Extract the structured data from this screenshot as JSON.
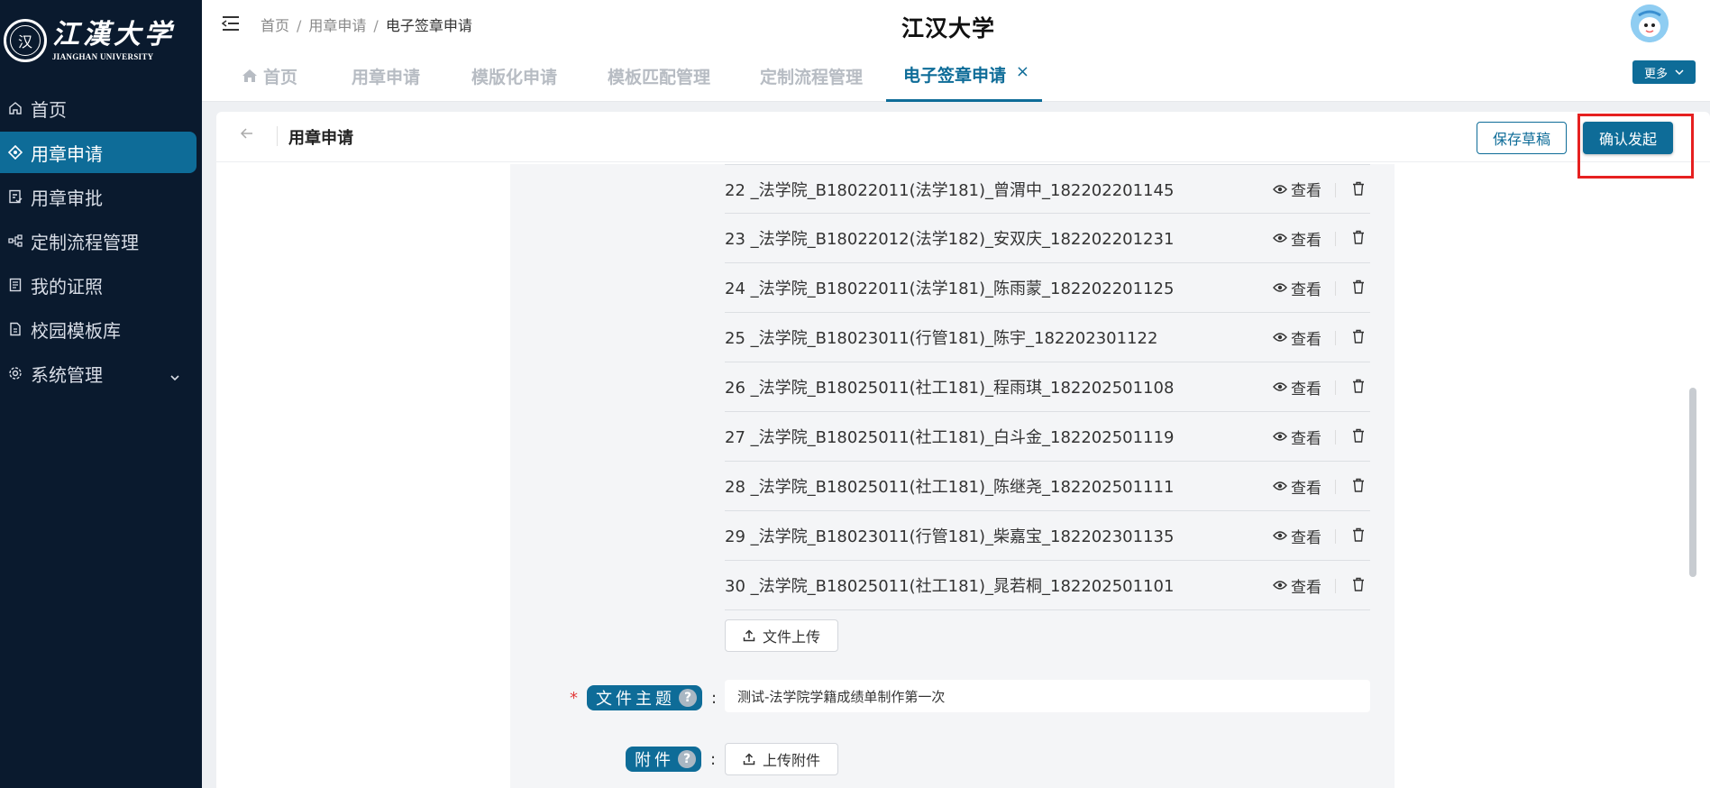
{
  "sidebar": {
    "logo_cn": "江漢大学",
    "logo_en": "JIANGHAN UNIVERSITY",
    "logo_seal": "汉",
    "items": [
      {
        "label": "首页",
        "icon": "home-icon",
        "active": false
      },
      {
        "label": "用章申请",
        "icon": "diamond-icon",
        "active": true
      },
      {
        "label": "用章审批",
        "icon": "approve-icon",
        "active": false
      },
      {
        "label": "定制流程管理",
        "icon": "flow-icon",
        "active": false
      },
      {
        "label": "我的证照",
        "icon": "certificate-icon",
        "active": false
      },
      {
        "label": "校园模板库",
        "icon": "template-icon",
        "active": false
      },
      {
        "label": "系统管理",
        "icon": "gear-icon",
        "active": false
      }
    ]
  },
  "header": {
    "breadcrumb": [
      "首页",
      "用章申请",
      "电子签章申请"
    ],
    "separator": "/",
    "title": "江汉大学"
  },
  "tabs": [
    {
      "label": "首页"
    },
    {
      "label": "用章申请"
    },
    {
      "label": "模版化申请"
    },
    {
      "label": "模板匹配管理"
    },
    {
      "label": "定制流程管理"
    },
    {
      "label": "电子签章申请",
      "active": true,
      "close": "×"
    }
  ],
  "more_button": "更多",
  "page": {
    "title": "用章申请",
    "save_draft": "保存草稿",
    "confirm_submit": "确认发起"
  },
  "files": [
    {
      "name": "22 _法学院_B18022011(法学181)_曾渭中_182202201145"
    },
    {
      "name": "23 _法学院_B18022012(法学182)_安双庆_182202201231"
    },
    {
      "name": "24 _法学院_B18022011(法学181)_陈雨蒙_182202201125"
    },
    {
      "name": "25 _法学院_B18023011(行管181)_陈宇_182202301122"
    },
    {
      "name": "26 _法学院_B18025011(社工181)_程雨琪_182202501108"
    },
    {
      "name": "27 _法学院_B18025011(社工181)_白斗金_182202501119"
    },
    {
      "name": "28 _法学院_B18025011(社工181)_陈继尧_182202501111"
    },
    {
      "name": "29 _法学院_B18023011(行管181)_柴嘉宝_182202301135"
    },
    {
      "name": "30 _法学院_B18025011(社工181)_晁若桐_182202501101"
    }
  ],
  "file_actions": {
    "view": "查看"
  },
  "upload_file": "文件上传",
  "form": {
    "subject_label": "文件主题",
    "subject_value": "测试-法学院学籍成绩单制作第一次",
    "attachment_label": "附件",
    "upload_attachment": "上传附件",
    "help": "?",
    "colon": ":",
    "required": "*"
  },
  "colors": {
    "accent": "#0e6c98",
    "sidebar": "#0a1a2e",
    "highlight": "#e62020"
  }
}
